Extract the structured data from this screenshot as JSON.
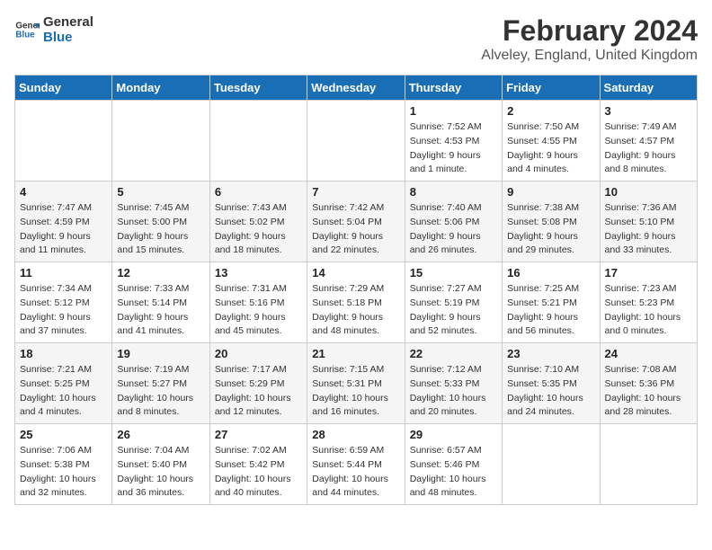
{
  "logo": {
    "line1": "General",
    "line2": "Blue"
  },
  "title": "February 2024",
  "subtitle": "Alveley, England, United Kingdom",
  "days_of_week": [
    "Sunday",
    "Monday",
    "Tuesday",
    "Wednesday",
    "Thursday",
    "Friday",
    "Saturday"
  ],
  "weeks": [
    [
      {
        "day": "",
        "info": ""
      },
      {
        "day": "",
        "info": ""
      },
      {
        "day": "",
        "info": ""
      },
      {
        "day": "",
        "info": ""
      },
      {
        "day": "1",
        "info": "Sunrise: 7:52 AM\nSunset: 4:53 PM\nDaylight: 9 hours\nand 1 minute."
      },
      {
        "day": "2",
        "info": "Sunrise: 7:50 AM\nSunset: 4:55 PM\nDaylight: 9 hours\nand 4 minutes."
      },
      {
        "day": "3",
        "info": "Sunrise: 7:49 AM\nSunset: 4:57 PM\nDaylight: 9 hours\nand 8 minutes."
      }
    ],
    [
      {
        "day": "4",
        "info": "Sunrise: 7:47 AM\nSunset: 4:59 PM\nDaylight: 9 hours\nand 11 minutes."
      },
      {
        "day": "5",
        "info": "Sunrise: 7:45 AM\nSunset: 5:00 PM\nDaylight: 9 hours\nand 15 minutes."
      },
      {
        "day": "6",
        "info": "Sunrise: 7:43 AM\nSunset: 5:02 PM\nDaylight: 9 hours\nand 18 minutes."
      },
      {
        "day": "7",
        "info": "Sunrise: 7:42 AM\nSunset: 5:04 PM\nDaylight: 9 hours\nand 22 minutes."
      },
      {
        "day": "8",
        "info": "Sunrise: 7:40 AM\nSunset: 5:06 PM\nDaylight: 9 hours\nand 26 minutes."
      },
      {
        "day": "9",
        "info": "Sunrise: 7:38 AM\nSunset: 5:08 PM\nDaylight: 9 hours\nand 29 minutes."
      },
      {
        "day": "10",
        "info": "Sunrise: 7:36 AM\nSunset: 5:10 PM\nDaylight: 9 hours\nand 33 minutes."
      }
    ],
    [
      {
        "day": "11",
        "info": "Sunrise: 7:34 AM\nSunset: 5:12 PM\nDaylight: 9 hours\nand 37 minutes."
      },
      {
        "day": "12",
        "info": "Sunrise: 7:33 AM\nSunset: 5:14 PM\nDaylight: 9 hours\nand 41 minutes."
      },
      {
        "day": "13",
        "info": "Sunrise: 7:31 AM\nSunset: 5:16 PM\nDaylight: 9 hours\nand 45 minutes."
      },
      {
        "day": "14",
        "info": "Sunrise: 7:29 AM\nSunset: 5:18 PM\nDaylight: 9 hours\nand 48 minutes."
      },
      {
        "day": "15",
        "info": "Sunrise: 7:27 AM\nSunset: 5:19 PM\nDaylight: 9 hours\nand 52 minutes."
      },
      {
        "day": "16",
        "info": "Sunrise: 7:25 AM\nSunset: 5:21 PM\nDaylight: 9 hours\nand 56 minutes."
      },
      {
        "day": "17",
        "info": "Sunrise: 7:23 AM\nSunset: 5:23 PM\nDaylight: 10 hours\nand 0 minutes."
      }
    ],
    [
      {
        "day": "18",
        "info": "Sunrise: 7:21 AM\nSunset: 5:25 PM\nDaylight: 10 hours\nand 4 minutes."
      },
      {
        "day": "19",
        "info": "Sunrise: 7:19 AM\nSunset: 5:27 PM\nDaylight: 10 hours\nand 8 minutes."
      },
      {
        "day": "20",
        "info": "Sunrise: 7:17 AM\nSunset: 5:29 PM\nDaylight: 10 hours\nand 12 minutes."
      },
      {
        "day": "21",
        "info": "Sunrise: 7:15 AM\nSunset: 5:31 PM\nDaylight: 10 hours\nand 16 minutes."
      },
      {
        "day": "22",
        "info": "Sunrise: 7:12 AM\nSunset: 5:33 PM\nDaylight: 10 hours\nand 20 minutes."
      },
      {
        "day": "23",
        "info": "Sunrise: 7:10 AM\nSunset: 5:35 PM\nDaylight: 10 hours\nand 24 minutes."
      },
      {
        "day": "24",
        "info": "Sunrise: 7:08 AM\nSunset: 5:36 PM\nDaylight: 10 hours\nand 28 minutes."
      }
    ],
    [
      {
        "day": "25",
        "info": "Sunrise: 7:06 AM\nSunset: 5:38 PM\nDaylight: 10 hours\nand 32 minutes."
      },
      {
        "day": "26",
        "info": "Sunrise: 7:04 AM\nSunset: 5:40 PM\nDaylight: 10 hours\nand 36 minutes."
      },
      {
        "day": "27",
        "info": "Sunrise: 7:02 AM\nSunset: 5:42 PM\nDaylight: 10 hours\nand 40 minutes."
      },
      {
        "day": "28",
        "info": "Sunrise: 6:59 AM\nSunset: 5:44 PM\nDaylight: 10 hours\nand 44 minutes."
      },
      {
        "day": "29",
        "info": "Sunrise: 6:57 AM\nSunset: 5:46 PM\nDaylight: 10 hours\nand 48 minutes."
      },
      {
        "day": "",
        "info": ""
      },
      {
        "day": "",
        "info": ""
      }
    ]
  ]
}
